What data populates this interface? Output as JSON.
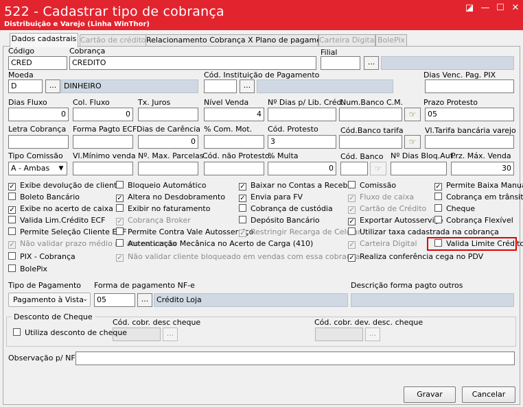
{
  "window": {
    "title": "522 - Cadastrar tipo de cobrança",
    "subtitle": "Distribuição e Varejo (Linha WinThor)",
    "controls": [
      "◪",
      "—",
      "☐",
      "✕"
    ]
  },
  "tabs": [
    {
      "label": "Dados cadastrais",
      "state": "active"
    },
    {
      "label": "Cartão de crédito",
      "state": "disabled"
    },
    {
      "label": "Relacionamento Cobrança X Plano de pagamento",
      "state": "enabled"
    },
    {
      "label": "Carteira Digital",
      "state": "disabled"
    },
    {
      "label": "BolePix",
      "state": "disabled"
    }
  ],
  "labels": {
    "codigo": "Código",
    "cobranca": "Cobrança",
    "filial": "Filial",
    "moeda": "Moeda",
    "cod_inst": "Cód. Instituição de Pagamento",
    "dias_venc": "Dias Venc. Pag. PIX",
    "dias_fluxo": "Dias Fluxo",
    "col_fluxo": "Col. Fluxo",
    "tx_juros": "Tx. Juros",
    "nivel_venda": "Nível Venda",
    "num_dias_lib": "Nº Dias p/ Lib. Créd.",
    "num_banco_cm": "Num.Banco C.M.",
    "prazo_protesto": "Prazo Protesto",
    "letra_cobranca": "Letra Cobrança",
    "forma_pagto_ecf": "Forma Pagto ECF",
    "dias_carencia": "Dias de Carência",
    "com_mot": "% Com. Mot.",
    "cod_protesto": "Cód. Protesto",
    "cod_banco_tarifa": "Cód.Banco tarifa",
    "vl_tarifa": "Vl.Tarifa bancária varejo",
    "tipo_comissao": "Tipo Comissão",
    "vl_minimo": "Vl.Mínimo venda",
    "max_parcelas": "Nº. Max. Parcelas",
    "cod_nao_protesto": "Cód. não Protesto.",
    "multa": "% Multa",
    "cod_banco": "Cód. Banco",
    "dias_bloq": "Nº Dias Bloq.Aut.",
    "prz_max_venda": "Prz. Máx. Venda",
    "tipo_pagamento": "Tipo de Pagamento",
    "forma_nfe": "Forma de pagamento NF-e",
    "desc_outros": "Descrição forma pagto outros",
    "desconto_cheque": "Desconto de Cheque",
    "cod_desc_cheque": "Cód. cobr. desc cheque",
    "cod_dev_cheque": "Cód. cobr. dev. desc. cheque",
    "observacao": "Observação p/ NF:"
  },
  "values": {
    "codigo": "CRED",
    "cobranca": "CREDITO",
    "filial": "",
    "moeda_code": "D",
    "moeda_desc": "DINHEIRO",
    "cod_inst": "",
    "dias_venc": "",
    "dias_fluxo": "0",
    "col_fluxo": "0",
    "tx_juros": "",
    "nivel_venda": "4",
    "num_dias_lib": "",
    "num_banco_cm": "",
    "prazo_protesto": "05",
    "letra_cobranca": "",
    "forma_pagto_ecf": "",
    "dias_carencia": "0",
    "com_mot": "",
    "cod_protesto": "3",
    "cod_banco_tarifa": "",
    "vl_tarifa": "",
    "tipo_comissao": "A - Ambas",
    "vl_minimo": "",
    "max_parcelas": "",
    "cod_nao_protesto": "",
    "multa": "0",
    "cod_banco": "",
    "dias_bloq": "",
    "prz_max_venda": "30",
    "tipo_pagamento": "Pagamento à Vista",
    "forma_nfe_code": "05",
    "forma_nfe_desc": "Crédito Loja",
    "desc_outros": "",
    "cod_desc_cheque": "",
    "cod_dev_cheque": "",
    "observacao": ""
  },
  "ellipsis": "...",
  "checkboxes": {
    "col1": [
      {
        "label": "Exibe devolução de cliente",
        "checked": true,
        "disabled": false
      },
      {
        "label": "Boleto Bancário",
        "checked": false,
        "disabled": false
      },
      {
        "label": "Exibe no acerto de caixa",
        "checked": true,
        "disabled": false
      },
      {
        "label": "Valida Lim.Crédito ECF",
        "checked": false,
        "disabled": false
      },
      {
        "label": "Permite Seleção Cliente ECF",
        "checked": false,
        "disabled": false
      },
      {
        "label": "Não validar prazo médio no ato na venda",
        "checked": true,
        "disabled": true
      },
      {
        "label": "PIX - Cobrança",
        "checked": false,
        "disabled": false
      },
      {
        "label": "BolePix",
        "checked": false,
        "disabled": false
      }
    ],
    "col2": [
      {
        "label": "Bloqueio Automático",
        "checked": false,
        "disabled": false
      },
      {
        "label": "Altera no Desdobramento",
        "checked": true,
        "disabled": false
      },
      {
        "label": "Exibir no faturamento",
        "checked": false,
        "disabled": false
      },
      {
        "label": "Cobrança Broker",
        "checked": true,
        "disabled": true
      },
      {
        "label": "Permite Contra Vale Autosserviço",
        "checked": false,
        "disabled": false
      },
      {
        "label": "Autenticação Mecânica no Acerto de Carga (410)",
        "checked": false,
        "disabled": false
      },
      {
        "label": "Não validar cliente bloqueado em vendas com essa cobrança",
        "checked": true,
        "disabled": true
      }
    ],
    "col3": [
      {
        "label": "Baixar no Contas a Receber",
        "checked": true,
        "disabled": false
      },
      {
        "label": "Envia para FV",
        "checked": true,
        "disabled": false
      },
      {
        "label": "Cobrança de custódia",
        "checked": false,
        "disabled": false
      },
      {
        "label": "Depósito Bancário",
        "checked": false,
        "disabled": false
      },
      {
        "label": "Restringir Recarga de Celular",
        "checked": true,
        "disabled": true
      }
    ],
    "col4": [
      {
        "label": "Comissão",
        "checked": false,
        "disabled": false
      },
      {
        "label": "Fluxo de caixa",
        "checked": true,
        "disabled": true
      },
      {
        "label": "Cartão de Crédito",
        "checked": true,
        "disabled": true
      },
      {
        "label": "Exportar Autosserviço",
        "checked": true,
        "disabled": false
      },
      {
        "label": "Utilizar taxa cadastrada na cobrança",
        "checked": false,
        "disabled": false
      },
      {
        "label": "Carteira Digital",
        "checked": true,
        "disabled": true
      },
      {
        "label": "Realiza conferência cega no PDV",
        "checked": true,
        "disabled": false
      }
    ],
    "col5": [
      {
        "label": "Permite Baixa Manual",
        "checked": true,
        "disabled": false
      },
      {
        "label": "Cobrança em trânsito",
        "checked": false,
        "disabled": false
      },
      {
        "label": "Cheque",
        "checked": false,
        "disabled": false
      },
      {
        "label": "Cobrança Flexível",
        "checked": false,
        "disabled": false
      },
      {
        "label": "Valida Limite Crédito",
        "checked": false,
        "disabled": false
      }
    ],
    "utiliza_desconto": {
      "label": "Utiliza desconto de cheque",
      "checked": false
    }
  },
  "buttons": {
    "gravar": "Gravar",
    "cancelar": "Cancelar"
  },
  "colors": {
    "titlebar": "#e2242f",
    "highlight": "#e10000",
    "readonly_field": "#d0d9e3"
  }
}
